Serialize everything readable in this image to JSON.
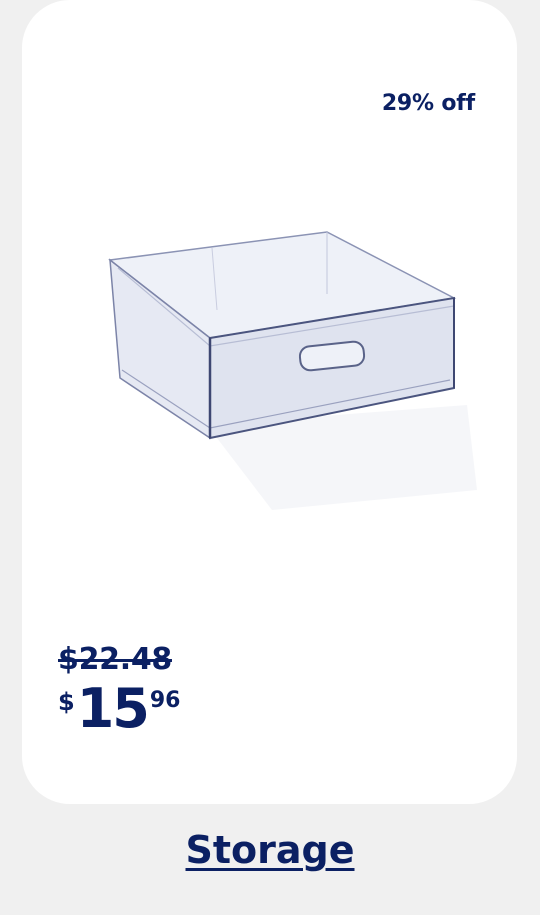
{
  "product": {
    "discount_label": "29% off",
    "was_price": "$22.48",
    "now_price": {
      "currency": "$",
      "dollars": "15",
      "cents": "96"
    },
    "image_icon": "clear-storage-drawer-image"
  },
  "category": {
    "link_label": "Storage"
  },
  "colors": {
    "brand_navy": "#0b2063",
    "card_bg": "#ffffff",
    "page_bg": "#f0f0f0"
  }
}
